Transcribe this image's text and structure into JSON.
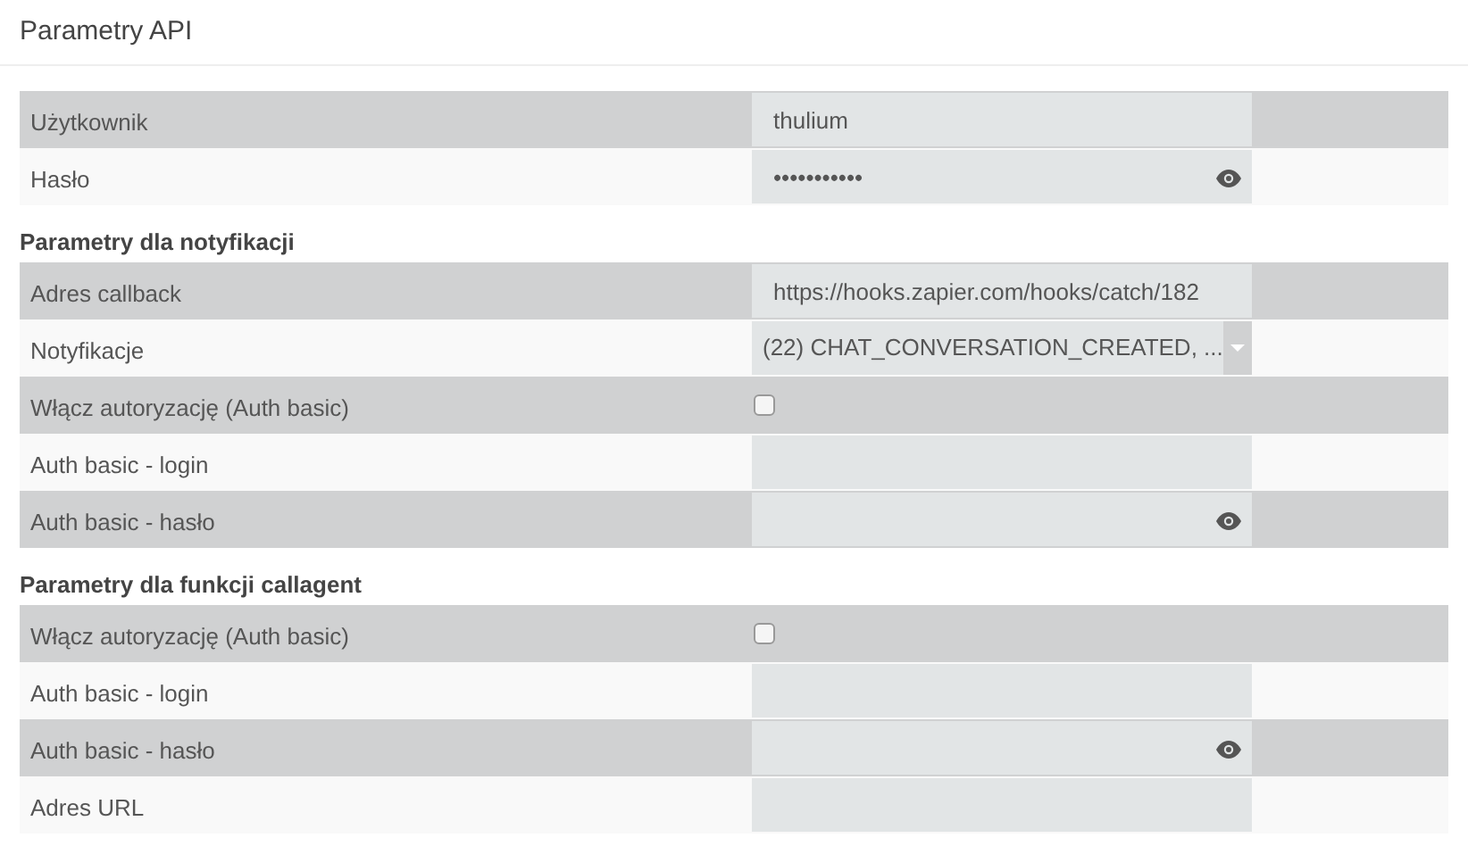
{
  "title": "Parametry API",
  "sections": [
    {
      "rows": [
        {
          "label": "Użytkownik",
          "kind": "text",
          "value": "thulium"
        },
        {
          "label": "Hasło",
          "kind": "password",
          "value": "•••••••••••"
        }
      ]
    },
    {
      "heading": "Parametry dla notyfikacji",
      "rows": [
        {
          "label": "Adres callback",
          "kind": "text",
          "value": "https://hooks.zapier.com/hooks/catch/182"
        },
        {
          "label": "Notyfikacje",
          "kind": "select",
          "value": "(22) CHAT_CONVERSATION_CREATED, ..."
        },
        {
          "label": "Włącz autoryzację (Auth basic)",
          "kind": "checkbox",
          "checked": false
        },
        {
          "label": "Auth basic - login",
          "kind": "text"
        },
        {
          "label": "Auth basic - hasło",
          "kind": "password"
        }
      ]
    },
    {
      "heading": "Parametry dla funkcji callagent",
      "rows": [
        {
          "label": "Włącz autoryzację (Auth basic)",
          "kind": "checkbox",
          "checked": false
        },
        {
          "label": "Auth basic - login",
          "kind": "text"
        },
        {
          "label": "Auth basic - hasło",
          "kind": "password"
        },
        {
          "label": "Adres URL",
          "kind": "text"
        }
      ]
    }
  ]
}
